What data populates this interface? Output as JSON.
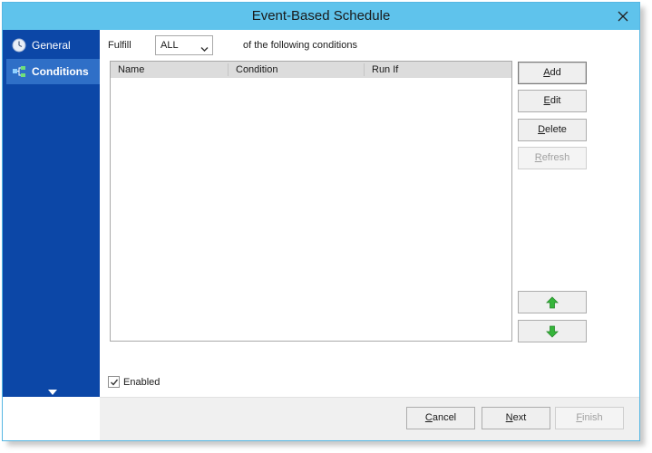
{
  "window": {
    "title": "Event-Based Schedule"
  },
  "sidebar": {
    "items": [
      {
        "label": "General",
        "icon": "clock-icon",
        "active": false
      },
      {
        "label": "Conditions",
        "icon": "conditions-icon",
        "active": true
      }
    ],
    "expand_icon": "chevron-down-icon"
  },
  "conditions": {
    "fulfill_label": "Fulfill",
    "fulfill_value": "ALL",
    "suffix_label": "of the following conditions",
    "columns": [
      "Name",
      "Condition",
      "Run If"
    ],
    "rows": []
  },
  "actions": {
    "add": {
      "first": "A",
      "rest": "dd"
    },
    "edit": {
      "first": "E",
      "rest": "dit"
    },
    "delete": {
      "first": "D",
      "rest": "elete"
    },
    "refresh": {
      "first": "R",
      "rest": "efresh"
    },
    "move_up_icon": "arrow-up-icon",
    "move_down_icon": "arrow-down-icon"
  },
  "enabled": {
    "label": "Enabled",
    "checked": true
  },
  "footer": {
    "cancel": {
      "first": "C",
      "rest": "ancel"
    },
    "next": {
      "first": "N",
      "rest": "ext"
    },
    "finish": {
      "first": "F",
      "rest": "inish"
    }
  },
  "colors": {
    "titlebar": "#5fc3ec",
    "sidebar": "#0c47a7",
    "sidebar_active": "#2f6fc7",
    "arrows": "#35b53a"
  }
}
